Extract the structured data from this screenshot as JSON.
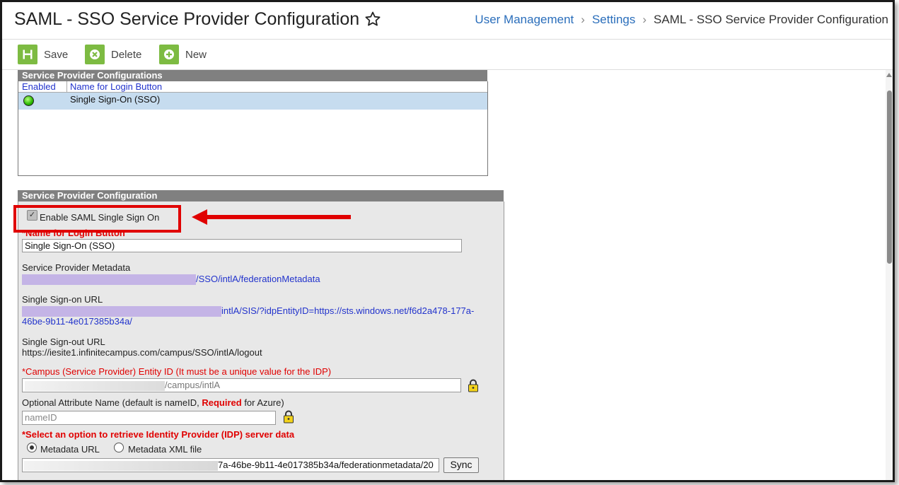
{
  "header": {
    "title": "SAML - SSO Service Provider Configuration",
    "breadcrumb": [
      "User Management",
      "Settings",
      "SAML - SSO Service Provider Configuration"
    ]
  },
  "toolbar": {
    "save_label": "Save",
    "delete_label": "Delete",
    "new_label": "New"
  },
  "configurations_panel": {
    "title": "Service Provider Configurations",
    "columns": [
      "Enabled",
      "Name for Login Button"
    ],
    "rows": [
      {
        "enabled": true,
        "name": "Single Sign-On (SSO)"
      }
    ]
  },
  "config_form": {
    "title": "Service Provider Configuration",
    "enable_saml_label": "Enable SAML Single Sign On",
    "enable_saml_checked": true,
    "login_button_label": "*Name for Login Button",
    "login_button_value": "Single Sign-On (SSO)",
    "metadata_label": "Service Provider Metadata",
    "metadata_url_visible": "/SSO/intlA/federationMetadata",
    "sso_url_label": "Single Sign-on URL",
    "sso_url_line1": "intlA/SIS/?idpEntityID=https://sts.windows.net/f6d2a478-177a-",
    "sso_url_line2": "46be-9b11-4e017385b34a/",
    "slo_url_label": "Single Sign-out URL",
    "slo_url": "https://iesite1.infinitecampus.com/campus/SSO/intlA/logout",
    "entity_id_label": "*Campus (Service Provider) Entity ID (It must be a unique value for the IDP)",
    "entity_id_value": "/campus/intlA",
    "attr_label_pre": "Optional Attribute Name (default is nameID, ",
    "attr_label_required": "Required",
    "attr_label_post": " for Azure)",
    "attr_placeholder": "nameID",
    "idp_label": "*Select an option to retrieve Identity Provider (IDP) server data",
    "option_metadata_url": "Metadata URL",
    "option_metadata_xml": "Metadata XML file",
    "selected_option": "Metadata URL",
    "idp_url_value": "7a-46be-9b11-4e017385b34a/federationmetadata/20",
    "sync_label": "Sync"
  },
  "colors": {
    "accent_green": "#7dbb42",
    "link_blue": "#2a6ebb",
    "required_red": "#e00000",
    "selected_row": "#c6dcef",
    "panel_header": "#808080"
  }
}
